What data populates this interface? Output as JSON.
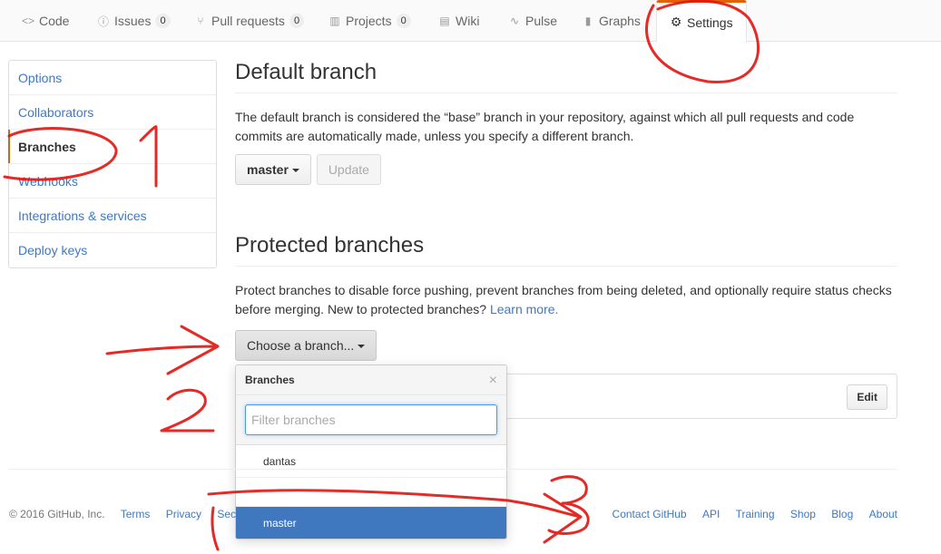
{
  "tabs": [
    {
      "label": "Code",
      "icon": "code-icon",
      "glyph": "<>"
    },
    {
      "label": "Issues",
      "icon": "issue-icon",
      "glyph": "ⓘ",
      "count": "0"
    },
    {
      "label": "Pull requests",
      "icon": "pull-request-icon",
      "glyph": "⑂",
      "count": "0"
    },
    {
      "label": "Projects",
      "icon": "project-icon",
      "glyph": "▥",
      "count": "0"
    },
    {
      "label": "Wiki",
      "icon": "book-icon",
      "glyph": "▤"
    },
    {
      "label": "Pulse",
      "icon": "pulse-icon",
      "glyph": "∿"
    },
    {
      "label": "Graphs",
      "icon": "graph-icon",
      "glyph": "▮"
    },
    {
      "label": "Settings",
      "icon": "gear-icon",
      "glyph": "⚙"
    }
  ],
  "sidebar": {
    "items": [
      {
        "label": "Options"
      },
      {
        "label": "Collaborators"
      },
      {
        "label": "Branches"
      },
      {
        "label": "Webhooks"
      },
      {
        "label": "Integrations & services"
      },
      {
        "label": "Deploy keys"
      }
    ]
  },
  "default_branch": {
    "title": "Default branch",
    "description": "The default branch is considered the “base” branch in your repository, against which all pull requests and code commits are automatically made, unless you specify a different branch.",
    "branch_select": "master",
    "update_label": "Update"
  },
  "protected": {
    "title": "Protected branches",
    "description": "Protect branches to disable force pushing, prevent branches from being deleted, and optionally require status checks before merging. New to protected branches?",
    "learn_more": "Learn more.",
    "choose_label": "Choose a branch...",
    "edit_label": "Edit"
  },
  "dropdown": {
    "title": "Branches",
    "close": "×",
    "filter_placeholder": "Filter branches",
    "items": [
      "dantas",
      "master"
    ]
  },
  "footer": {
    "copyright": "© 2016 GitHub, Inc.",
    "left_links": [
      "Terms",
      "Privacy",
      "Security"
    ],
    "right_links": [
      "Contact GitHub",
      "API",
      "Training",
      "Shop",
      "Blog",
      "About"
    ]
  },
  "annotations": {
    "color": "#e0140f",
    "marks": [
      "1",
      "2.",
      "3"
    ]
  }
}
